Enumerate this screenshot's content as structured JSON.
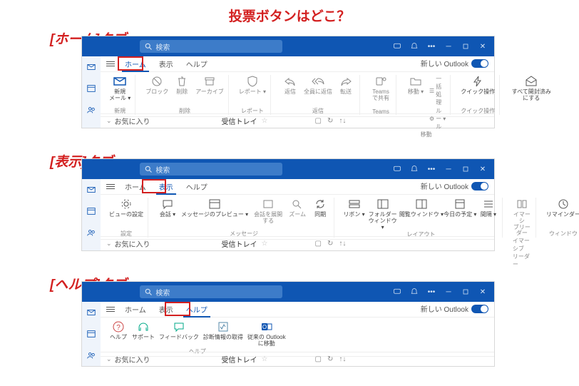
{
  "page_title": "投票ボタンはどこ？",
  "section_labels": [
    "[ホーム]タブ",
    "[表示]タブ",
    "[ヘルプ]タブ"
  ],
  "search_placeholder": "検索",
  "tabs": {
    "home": "ホーム",
    "view": "表示",
    "help": "ヘルプ"
  },
  "new_outlook_label": "新しい Outlook",
  "favorites": "お気に入り",
  "inbox": "受信トレイ",
  "home_ribbon": {
    "new": {
      "label": "新規",
      "sub": "メール",
      "group": "新規"
    },
    "delete_group": {
      "block": "ブロック",
      "delete": "削除",
      "archive": "アーカイブ",
      "group": "削除"
    },
    "report_group": {
      "report": "レポート",
      "group": "レポート"
    },
    "respond_group": {
      "reply": "返信",
      "replyall": "全員に返信",
      "forward": "転送",
      "group": "返信"
    },
    "teams_group": {
      "teams": "Teams で共有",
      "group": "Teams"
    },
    "move_group": {
      "move": "移動",
      "rules": "ルール",
      "quickactions": "一括処理",
      "group": "移動"
    },
    "quick_group": {
      "quickop": "クイック操作",
      "group": "クイック操作"
    },
    "read_group": {
      "markread": "すべて開封済みにする"
    }
  },
  "view_ribbon": {
    "settings": {
      "label": "ビューの設定",
      "group": "設定"
    },
    "messages": {
      "conv": "会話",
      "preview": "メッセージのプレビュー",
      "expand": "会話を展開する",
      "zoom": "ズーム",
      "sync": "同期",
      "group": "メッセージ"
    },
    "layout": {
      "ribbon": "リボン",
      "folder": "フォルダー\nウィンドウ",
      "reading": "閲覧ウィンドウ",
      "today": "今日の予定",
      "spacing": "間隔",
      "group": "レイアウト"
    },
    "immersive": {
      "reader": "イマーシ\nブリーダー",
      "group": "イマーシブ リーダー"
    },
    "window": {
      "reminder": "リマインダー",
      "group": "ウィンドウ"
    }
  },
  "help_ribbon": {
    "help": "ヘルプ",
    "support": "サポート",
    "feedback": "フィードバック",
    "diag": "診断情報の取得",
    "classic": "従来の Outlook\nに移動",
    "group": "ヘルプ"
  }
}
